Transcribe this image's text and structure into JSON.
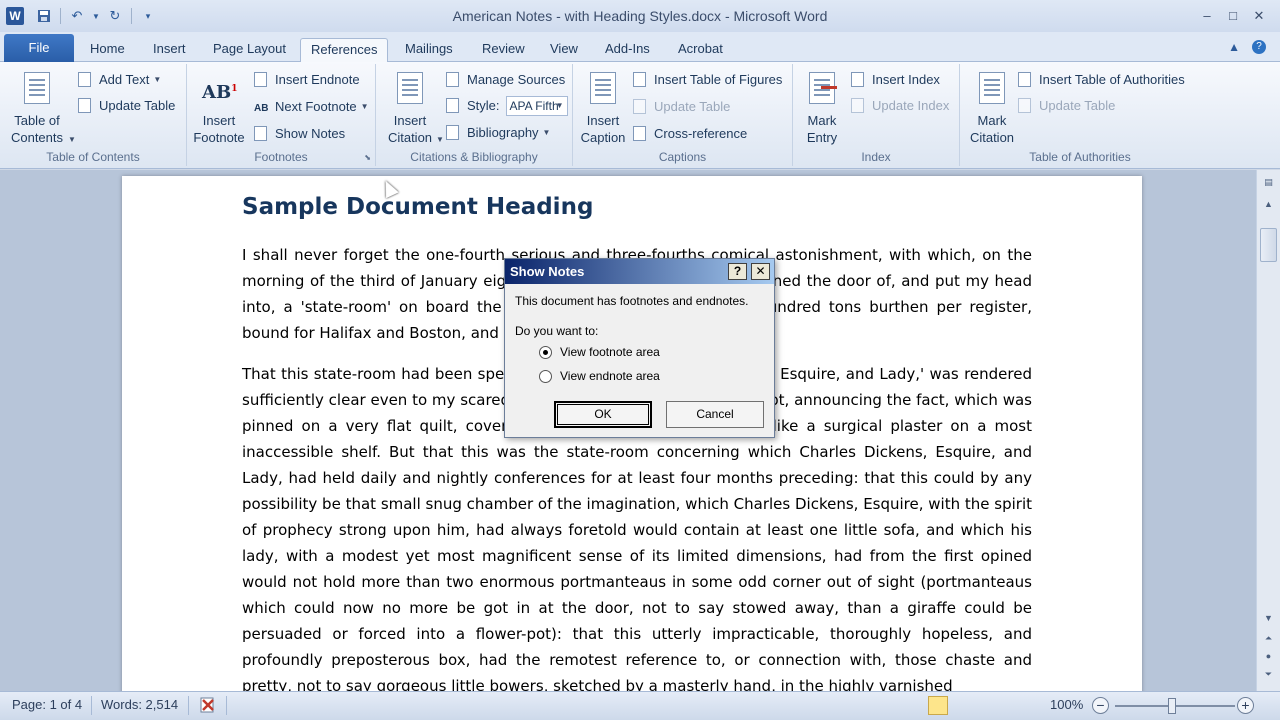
{
  "window": {
    "title": "American Notes - with Heading Styles.docx  -  Microsoft Word",
    "app_icon": "W",
    "controls": [
      "–",
      "□",
      "✕"
    ]
  },
  "tabs": [
    "File",
    "Home",
    "Insert",
    "Page Layout",
    "References",
    "Mailings",
    "Review",
    "View",
    "Add-Ins",
    "Acrobat"
  ],
  "active_tab": "References",
  "ribbon": {
    "toc": {
      "table_of_contents": "Table of\nContents",
      "add_text": "Add Text",
      "update_table": "Update Table",
      "label": "Table of Contents"
    },
    "footnotes": {
      "insert_footnote": "Insert\nFootnote",
      "insert_endnote": "Insert Endnote",
      "next_footnote": "Next Footnote",
      "show_notes": "Show Notes",
      "label": "Footnotes"
    },
    "citations": {
      "insert_citation": "Insert\nCitation",
      "manage_sources": "Manage Sources",
      "style_label": "Style:",
      "style_value": "APA Fifth",
      "bibliography": "Bibliography",
      "label": "Citations & Bibliography"
    },
    "captions": {
      "insert_caption": "Insert\nCaption",
      "insert_table_of_figures": "Insert Table of Figures",
      "update_table": "Update Table",
      "cross_reference": "Cross-reference",
      "label": "Captions"
    },
    "index": {
      "mark_entry": "Mark\nEntry",
      "insert_index": "Insert Index",
      "update_index": "Update Index",
      "label": "Index"
    },
    "authorities": {
      "mark_citation": "Mark\nCitation",
      "insert_table_of_authorities": "Insert Table of Authorities",
      "update_table": "Update Table",
      "label": "Table of Authorities"
    }
  },
  "document": {
    "heading": "Sample Document Heading",
    "paragraph1": "I shall never forget the one-fourth serious and three-fourths comical astonishment, with which, on the morning of the third of January eighteen-hundred-and-forty-two, I opened the door of, and put my head into, a 'state-room' on board the Britannia steam-packet, twelve hundred tons burthen per register, bound for Halifax and Boston, and carrying Her Majesty's mails.",
    "paragraph2": "That this state-room had been specially engaged for 'Charles Dickens, Esquire, and Lady,' was rendered sufficiently clear even to my scared intellect by a very small manuscript, announcing the fact, which was pinned on a very flat quilt, covering a very thin mattress, spread like a surgical plaster on a most inaccessible shelf. But that this was the state-room concerning which Charles Dickens, Esquire, and Lady, had held daily and nightly conferences for at least four months preceding: that this could by any possibility be that small snug chamber of the imagination, which Charles Dickens, Esquire, with the spirit of prophecy strong upon him, had always foretold would contain at least one little sofa, and which his lady, with a modest yet most magnificent sense of its limited dimensions, had from the first opined would not hold more than two enormous portmanteaus in some odd corner out of sight (portmanteaus which could now no more be got in at the door, not to say stowed away, than a giraffe could be persuaded or forced into a flower-pot): that this utterly impracticable, thoroughly hopeless, and profoundly preposterous box, had the remotest reference to, or connection with, those chaste and pretty, not to say gorgeous little bowers, sketched by a masterly hand, in the highly varnished"
  },
  "dialog": {
    "title": "Show Notes",
    "help": "?",
    "close": "✕",
    "message": "This document has footnotes and endnotes.",
    "prompt": "Do you want to:",
    "option1": "View footnote area",
    "option2": "View endnote area",
    "ok": "OK",
    "cancel": "Cancel"
  },
  "status": {
    "page": "Page: 1 of 4",
    "words": "Words: 2,514",
    "zoom": "100%",
    "zoom_level": 1.0
  },
  "colors": {
    "file_tab": "#2a5ea8",
    "heading": "#17365d",
    "dialog_title_start": "#0a246a",
    "dialog_title_end": "#a6caf0"
  }
}
